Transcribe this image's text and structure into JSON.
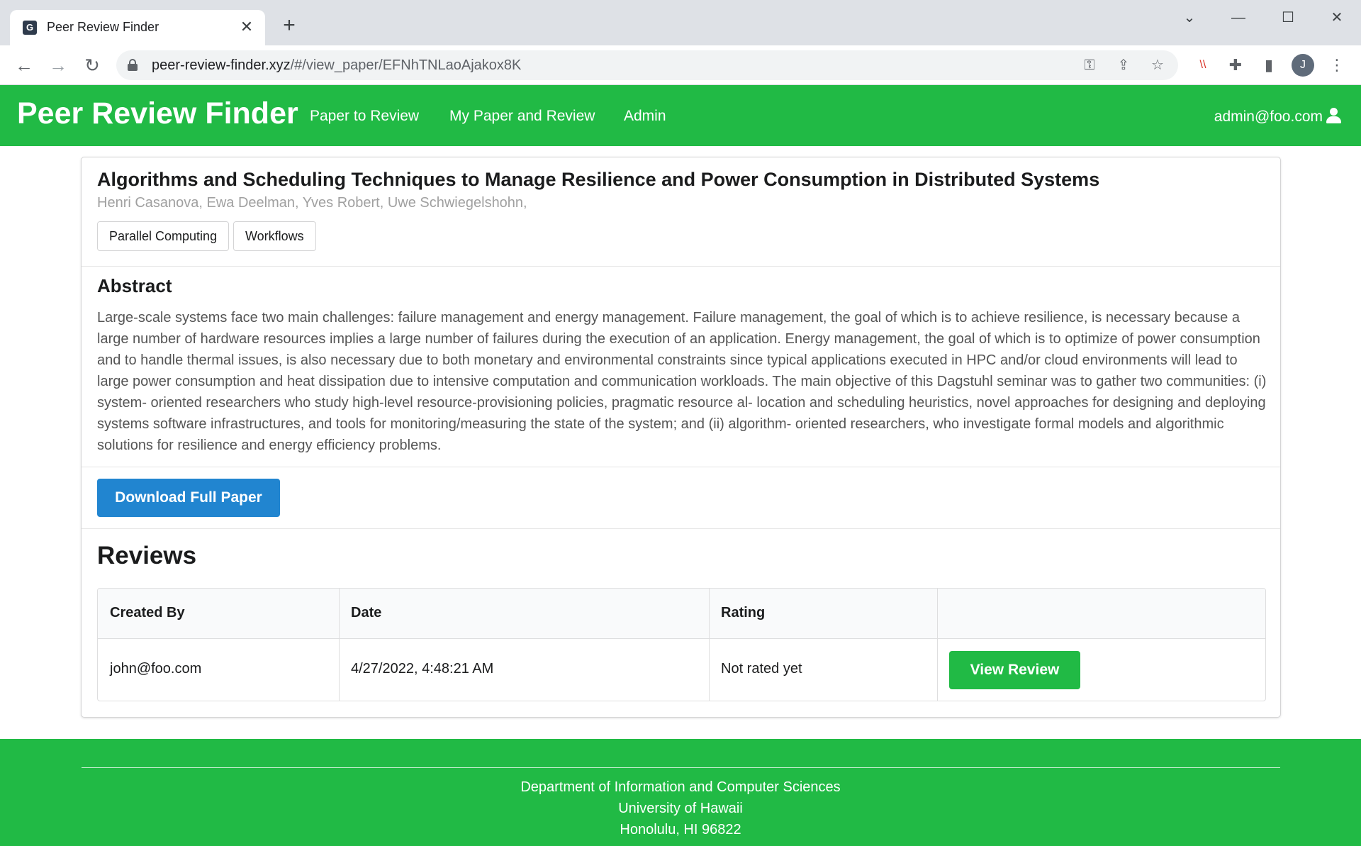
{
  "browser": {
    "tab_title": "Peer Review Finder",
    "favicon_glyph": "G",
    "new_tab_symbol": "+",
    "url_host": "peer-review-finder.xyz",
    "url_path": "/#/view_paper/EFNhTNLaoAjakox8K",
    "profile_initial": "J",
    "icons": {
      "back": "←",
      "forward": "→",
      "reload": "↻",
      "key": "⚿",
      "share": "⇪",
      "star": "☆",
      "extension_red": "\\\\",
      "puzzle": "✚",
      "sidepanel": "▮",
      "menu": "⋮",
      "chevron": "⌄",
      "minimize": "—",
      "maximize": "☐",
      "close": "✕"
    }
  },
  "header": {
    "brand": "Peer Review Finder",
    "nav": [
      "Paper to Review",
      "My Paper and Review",
      "Admin"
    ],
    "user_email": "admin@foo.com",
    "bg_color": "#21ba45"
  },
  "paper": {
    "title": "Algorithms and Scheduling Techniques to Manage Resilience and Power Consumption in Distributed Systems",
    "authors": "Henri Casanova, Ewa Deelman, Yves Robert, Uwe Schwiegelshohn,",
    "tags": [
      "Parallel Computing",
      "Workflows"
    ],
    "abstract_heading": "Abstract",
    "abstract": "Large-scale systems face two main challenges: failure management and energy management. Failure management, the goal of which is to achieve resilience, is necessary because a large number of hardware resources implies a large number of failures during the execution of an application. Energy management, the goal of which is to optimize of power consumption and to handle thermal issues, is also necessary due to both monetary and environmental constraints since typical applications executed in HPC and/or cloud environments will lead to large power consumption and heat dissipation due to intensive computation and communication workloads. The main objective of this Dagstuhl seminar was to gather two communities: (i) system- oriented researchers who study high-level resource-provisioning policies, pragmatic resource al- location and scheduling heuristics, novel approaches for designing and deploying systems software infrastructures, and tools for monitoring/measuring the state of the system; and (ii) algorithm- oriented researchers, who investigate formal models and algorithmic solutions for resilience and energy efficiency problems.",
    "download_label": "Download Full Paper",
    "download_color": "#2185d0"
  },
  "reviews": {
    "heading": "Reviews",
    "columns": [
      "Created By",
      "Date",
      "Rating",
      ""
    ],
    "rows": [
      {
        "created_by": "john@foo.com",
        "date": "4/27/2022, 4:48:21 AM",
        "rating": "Not rated yet",
        "action": "View Review"
      }
    ]
  },
  "footer": {
    "lines": [
      "Department of Information and Computer Sciences",
      "University of Hawaii",
      "Honolulu, HI 96822"
    ]
  }
}
